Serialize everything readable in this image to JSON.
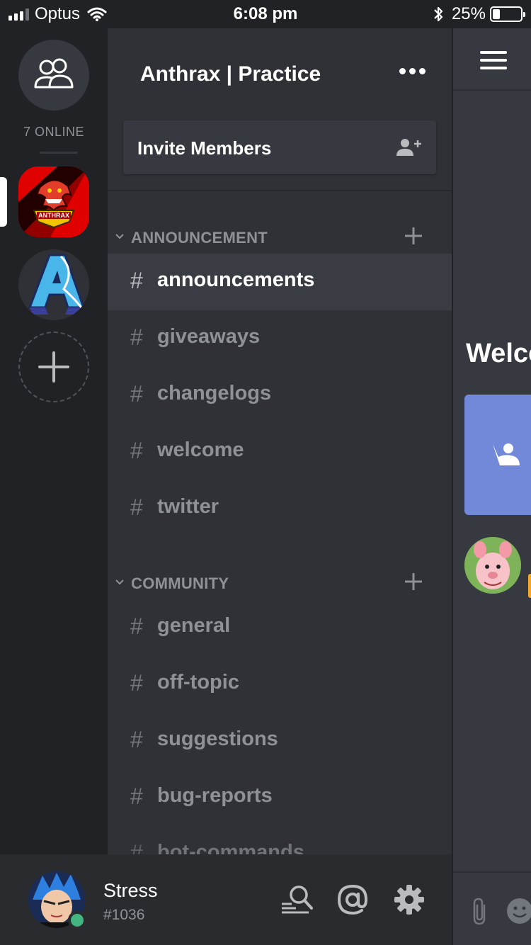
{
  "status_bar": {
    "carrier": "Optus",
    "time": "6:08 pm",
    "battery_percent": "25%",
    "battery_level": 0.25
  },
  "server_rail": {
    "online_label": "7 ONLINE",
    "servers": [
      {
        "name": "Anthrax",
        "icon": "anthrax-logo",
        "selected": true
      },
      {
        "name": "A",
        "icon": "a-logo",
        "selected": false
      }
    ]
  },
  "guild": {
    "name": "Anthrax | Practice",
    "invite_label": "Invite Members"
  },
  "categories": [
    {
      "label": "ANNOUNCEMENT",
      "channels": [
        "announcements",
        "giveaways",
        "changelogs",
        "welcome",
        "twitter"
      ]
    },
    {
      "label": "COMMUNITY",
      "channels": [
        "general",
        "off-topic",
        "suggestions",
        "bug-reports",
        "bot-commands"
      ]
    }
  ],
  "active_channel": "announcements",
  "chat_peek": {
    "welcome_text": "Welco"
  },
  "user": {
    "username": "Stress",
    "discriminator": "#1036",
    "status": "online"
  },
  "colors": {
    "rail_bg": "#202225",
    "panel_bg": "#2f3136",
    "chat_bg": "#36393f",
    "blurple": "#7289da",
    "online": "#43b581",
    "anthrax_red": "#e00000"
  }
}
